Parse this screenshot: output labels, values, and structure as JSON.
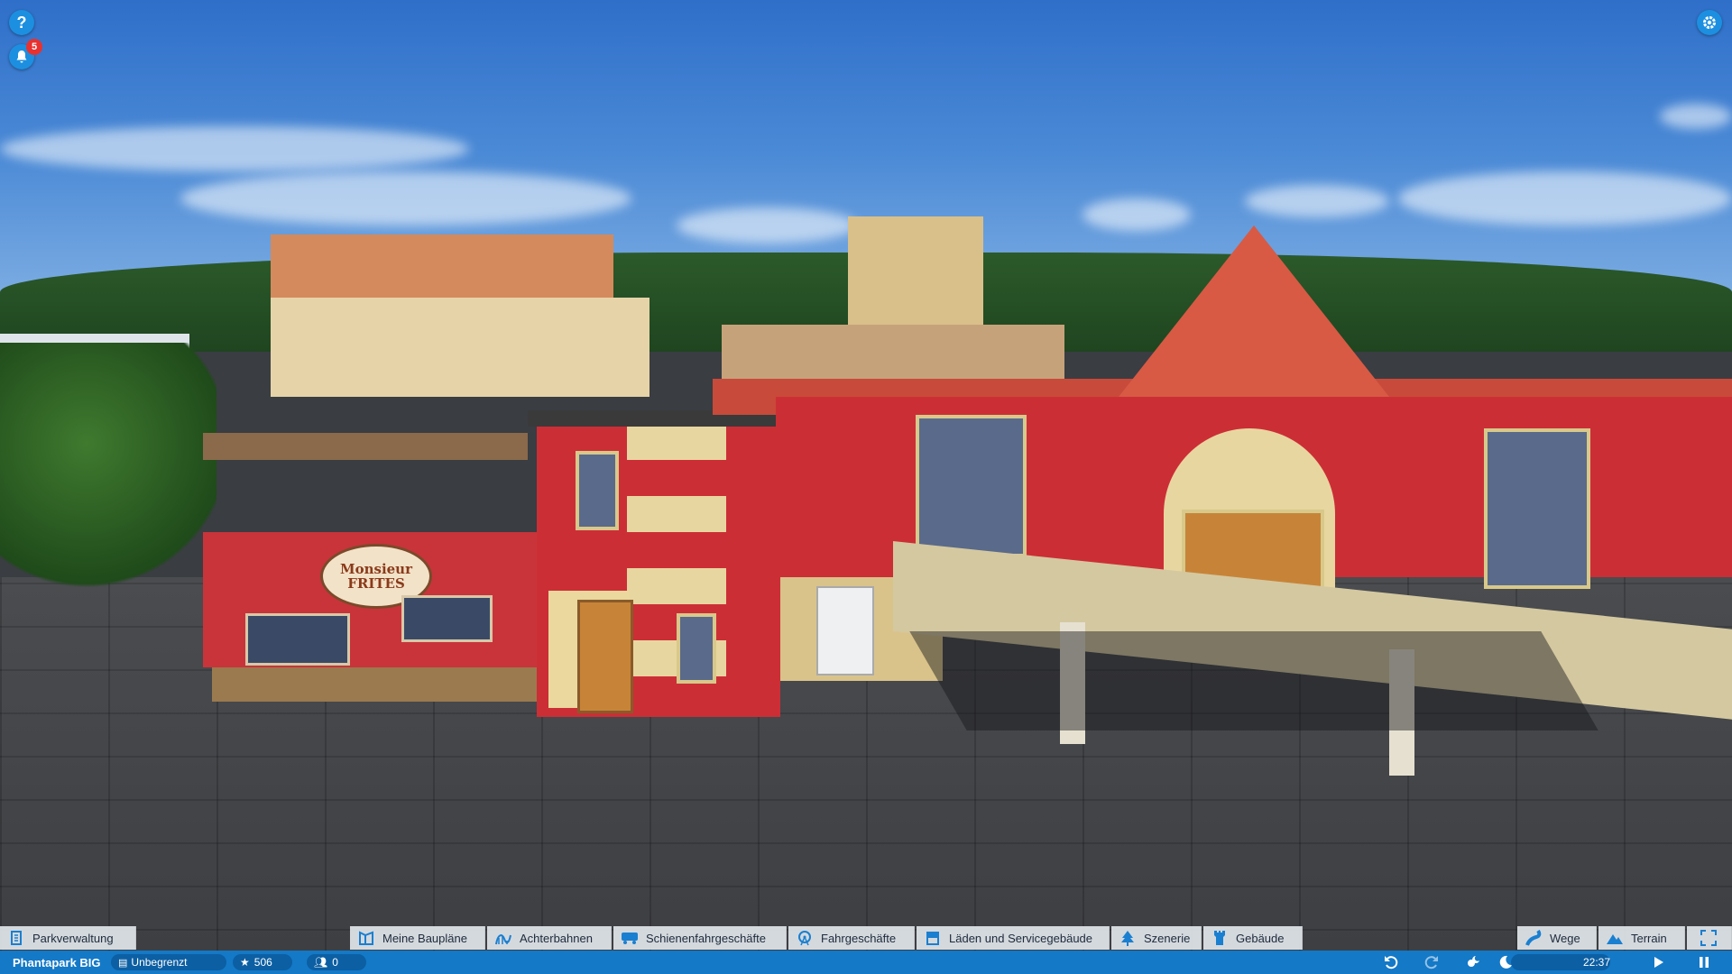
{
  "hud": {
    "help_icon": "question-mark",
    "notifications_icon": "bell",
    "notifications_count": "5",
    "settings_icon": "gear"
  },
  "scene": {
    "shop_sign": "Monsieur FRITES"
  },
  "toolbar": {
    "park_management": {
      "label": "Parkverwaltung",
      "icon": "park-management"
    },
    "tabs": [
      {
        "label": "Meine Baupläne",
        "icon": "blueprint"
      },
      {
        "label": "Achterbahnen",
        "icon": "coaster"
      },
      {
        "label": "Schienenfahrgeschäfte",
        "icon": "train"
      },
      {
        "label": "Fahrgeschäfte",
        "icon": "ferris-wheel"
      },
      {
        "label": "Läden und Servicegebäude",
        "icon": "shop"
      },
      {
        "label": "Szenerie",
        "icon": "tree"
      },
      {
        "label": "Gebäude",
        "icon": "tower"
      }
    ],
    "right_tabs": [
      {
        "label": "Wege",
        "icon": "path"
      },
      {
        "label": "Terrain",
        "icon": "mountain"
      }
    ],
    "fullscreen_icon": "expand"
  },
  "statusbar": {
    "park_name": "Phantapark BIG",
    "money": "Unbegrenzt",
    "rating": "506",
    "guests": "0",
    "time": "22:37",
    "accent": "#1479c7"
  }
}
